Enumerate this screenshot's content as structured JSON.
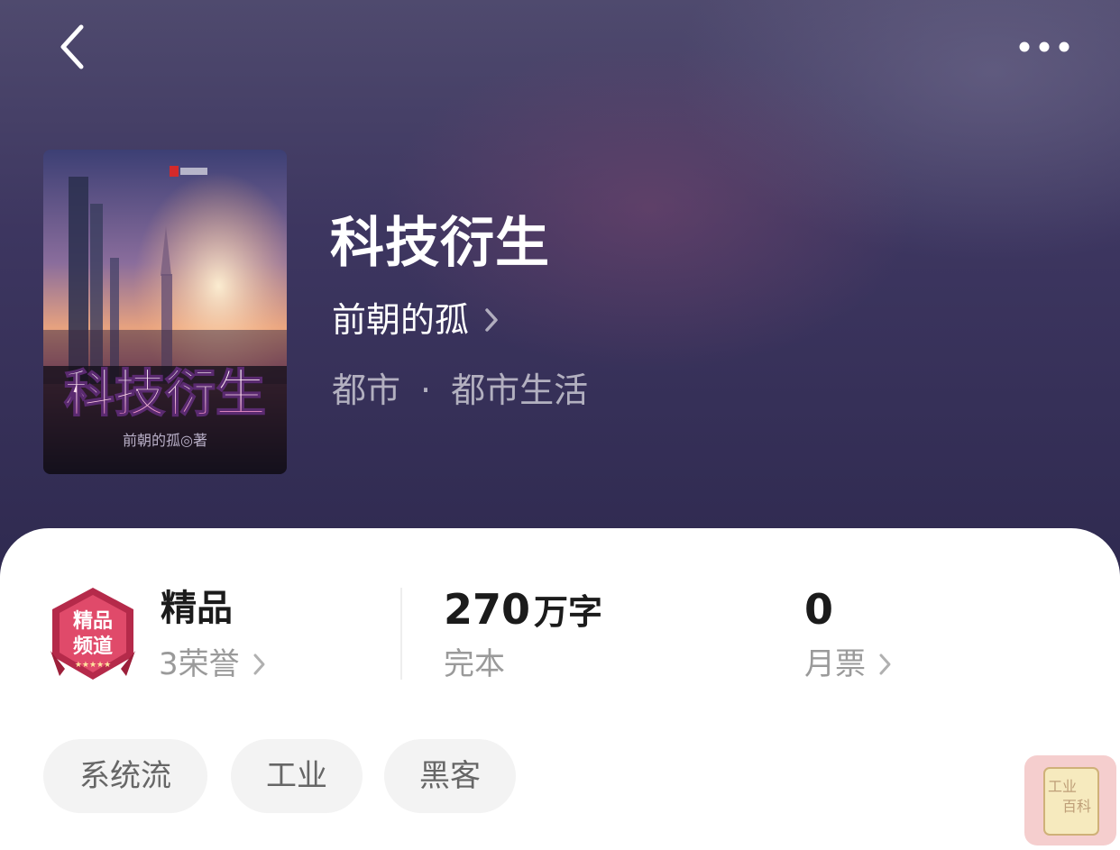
{
  "book": {
    "title": "科技衍生",
    "author": "前朝的孤",
    "category_main": "都市",
    "category_separator": "·",
    "category_sub": "都市生活",
    "cover_title": "科技衍生",
    "cover_author": "前朝的孤◎著"
  },
  "stats": {
    "quality": {
      "label": "精品",
      "honor_count": "3",
      "honor_label": "荣誉",
      "badge_text_top": "精品",
      "badge_text_bottom": "频道"
    },
    "words": {
      "number": "270",
      "unit": "万字",
      "status": "完本"
    },
    "monthly_ticket": {
      "number": "0",
      "label": "月票"
    }
  },
  "tags": [
    "系统流",
    "工业",
    "黑客"
  ],
  "watermark": {
    "line1": "工业",
    "line2": "百科"
  },
  "icons": {
    "back": "chevron-left-icon",
    "more": "more-dots-icon",
    "arrow": "chevron-right-icon"
  },
  "colors": {
    "header_top": "#4f4a6e",
    "header_bottom": "#2f2a50",
    "text_dark": "#1b1b1b",
    "text_muted": "#9a9a9a",
    "tag_bg": "#f3f3f3"
  }
}
